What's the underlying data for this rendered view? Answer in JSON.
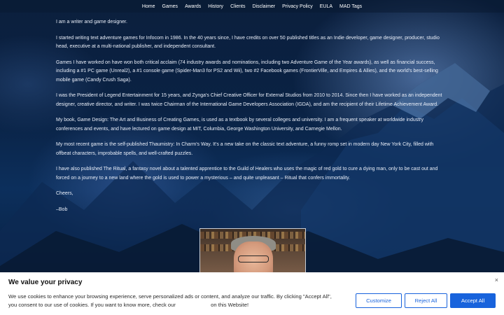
{
  "nav": {
    "items": [
      "Home",
      "Games",
      "Awards",
      "History",
      "Clients",
      "Disclaimer",
      "Privacy Policy",
      "EULA",
      "MAD Tags"
    ]
  },
  "content": {
    "paragraphs": [
      "I am a writer and game designer.",
      "I started writing text adventure games for Infocom in 1986. In the 40 years since, I have credits on over 50 published titles as an Indie developer, game designer, producer, studio head, executive at a multi-national publisher, and independent consultant.",
      "Games I have worked on have won both critical acclaim (74 industry awards and nominations, including two Adventure Game of the Year awards), as well as financial success, including a #1 PC game (Unreal2), a #1 console game (Spider-Man3 for PS2 and Wii), two #2 Facebook games (FrontierVille, and Empires & Allies), and the world's best-selling mobile game (Candy Crush Saga).",
      "I was the President of Legend Entertainment for 15 years, and Zynga's Chief Creative Officer for External Studios from 2010 to 2014. Since then I have worked as an independent designer, creative director, and writer. I was twice Chairman of the International Game Developers Association (IGDA), and am the recipient of their Lifetime Achievement Award.",
      "My book, Game Design: The Art and Business of Creating Games, is used as a textbook by several colleges and university. I am a frequent speaker at worldwide industry conferences and events, and have lectured on game design at MIT, Columbia, George Washington University, and Carnegie Mellon.",
      "My most recent game is the self-published Thaumistry: In Charm's Way. It's a new take on the classic text adventure, a funny romp set in modern day New York City, filled with offbeat characters, improbable spells, and well-crafted puzzles.",
      "I have also published The Ritual, a fantasy novel about a talented apprentice to the Guild of Healers who uses the magic of red gold to cure a dying man, only to be cast out and forced on a journey to a new land where the gold is used to power a mysterious – and quite unpleasant – Ritual that confers immortality.",
      "Cheers,",
      "–Bob"
    ]
  },
  "consent": {
    "title": "We value your privacy",
    "message_line1": "We use cookies to enhance your browsing experience, serve personalized ads or content, and analyze our traffic. By clicking \"Accept All\",",
    "message_line2_start": "you consent to our use of cookies. If you want to know more, check our",
    "message_line2_end": "on this Website!",
    "customize_label": "Customize",
    "reject_label": "Reject All",
    "accept_label": "Accept All",
    "close_symbol": "×"
  },
  "colors": {
    "accent": "#1863dc"
  }
}
